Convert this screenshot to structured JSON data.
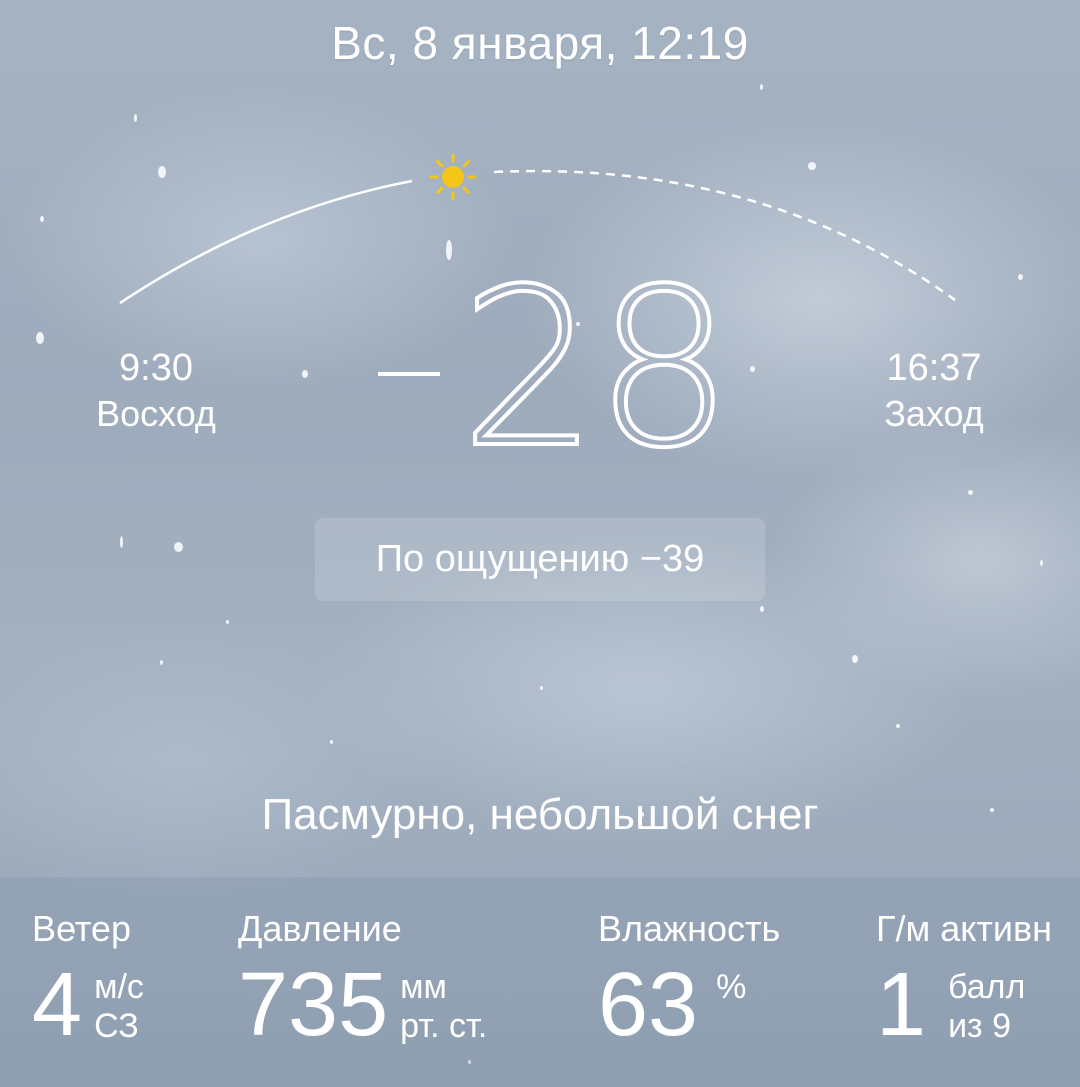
{
  "header": {
    "date_time": "Вс, 8 января, 12:19"
  },
  "sun": {
    "sunrise_time": "9:30",
    "sunrise_label": "Восход",
    "sunset_time": "16:37",
    "sunset_label": "Заход",
    "icon": "sun-icon",
    "sun_color": "#f5c518"
  },
  "current": {
    "temperature": "28",
    "temperature_sign": "−",
    "feels_like": "По ощущению −39",
    "condition": "Пасмурно, небольшой снег"
  },
  "metrics": {
    "wind": {
      "label": "Ветер",
      "value": "4",
      "unit_top": "м/с",
      "unit_bottom": "СЗ"
    },
    "pressure": {
      "label": "Давление",
      "value": "735",
      "unit_top": "мм",
      "unit_bottom": "рт. ст."
    },
    "humidity": {
      "label": "Влажность",
      "value": "63",
      "unit_top": "%",
      "unit_bottom": ""
    },
    "geomagnetic": {
      "label": "Г/м активн",
      "value": "1",
      "unit_top": "балл",
      "unit_bottom": "из 9"
    }
  }
}
